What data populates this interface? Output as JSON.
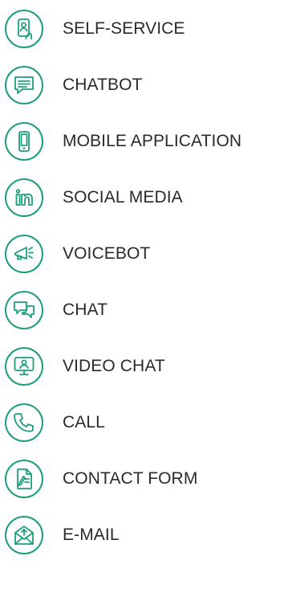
{
  "colors": {
    "accent": "#1f9e7e",
    "text": "#2a2a2a"
  },
  "channels": [
    {
      "label": "SELF-SERVICE",
      "icon": "self-service-icon"
    },
    {
      "label": "CHATBOT",
      "icon": "chatbot-icon"
    },
    {
      "label": "MOBILE APPLICATION",
      "icon": "mobile-phone-icon"
    },
    {
      "label": "SOCIAL MEDIA",
      "icon": "linkedin-icon"
    },
    {
      "label": "VOICEBOT",
      "icon": "megaphone-icon"
    },
    {
      "label": "CHAT",
      "icon": "chat-bubbles-icon"
    },
    {
      "label": "VIDEO CHAT",
      "icon": "video-chat-icon"
    },
    {
      "label": "CALL",
      "icon": "phone-call-icon"
    },
    {
      "label": "CONTACT FORM",
      "icon": "contact-form-icon"
    },
    {
      "label": "E-MAIL",
      "icon": "email-icon"
    }
  ]
}
